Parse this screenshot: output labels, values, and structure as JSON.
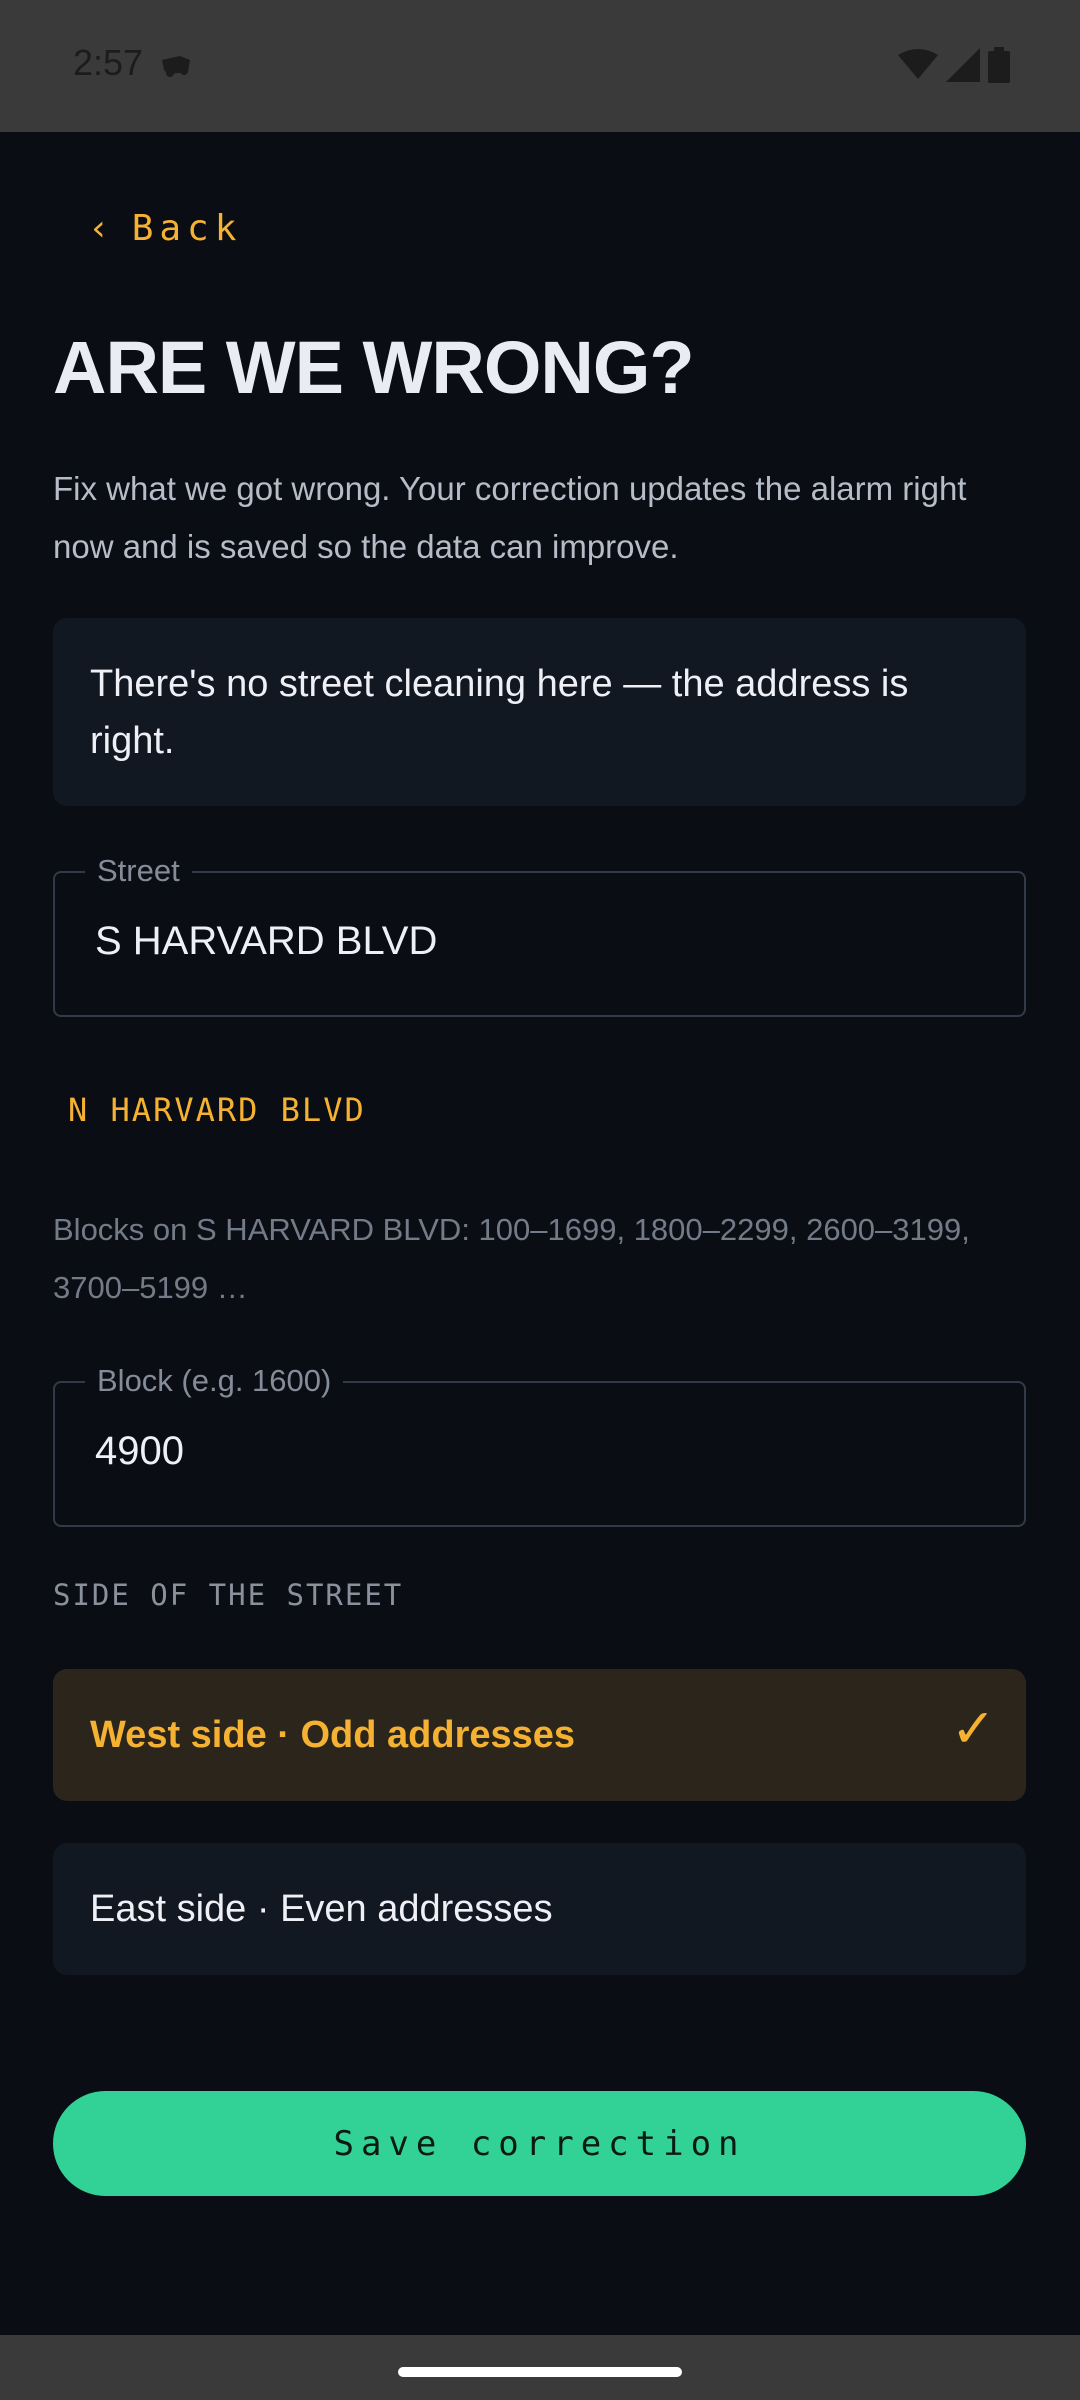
{
  "status_bar": {
    "time": "2:57",
    "icons": [
      "notification-icon",
      "wifi-icon",
      "signal-icon",
      "battery-icon"
    ]
  },
  "header": {
    "back_chevron": "‹",
    "back_label": "Back",
    "title": "ARE WE WRONG?",
    "subtitle": "Fix what we got wrong. Your correction updates the alarm right now and is saved so the data can improve."
  },
  "info_card": {
    "text": "There's no street cleaning here — the address is right."
  },
  "street_field": {
    "label": "Street",
    "value": "S HARVARD BLVD"
  },
  "suggestion": {
    "text": "N HARVARD BLVD"
  },
  "blocks_info": {
    "text": "Blocks on S HARVARD BLVD: 100–1699, 1800–2299, 2600–3199, 3700–5199 …"
  },
  "block_field": {
    "label": "Block (e.g. 1600)",
    "value": "4900"
  },
  "side_section": {
    "label": "SIDE OF THE STREET",
    "options": [
      {
        "label": "West side · Odd addresses",
        "selected": true,
        "check": "✓"
      },
      {
        "label": "East side · Even addresses",
        "selected": false
      }
    ]
  },
  "save_button": {
    "label": "Save correction"
  },
  "colors": {
    "background": "#0a0d13",
    "accent": "#f5b132",
    "primary_button": "#32d296",
    "card": "#121822",
    "selected_card": "#2c251b"
  }
}
